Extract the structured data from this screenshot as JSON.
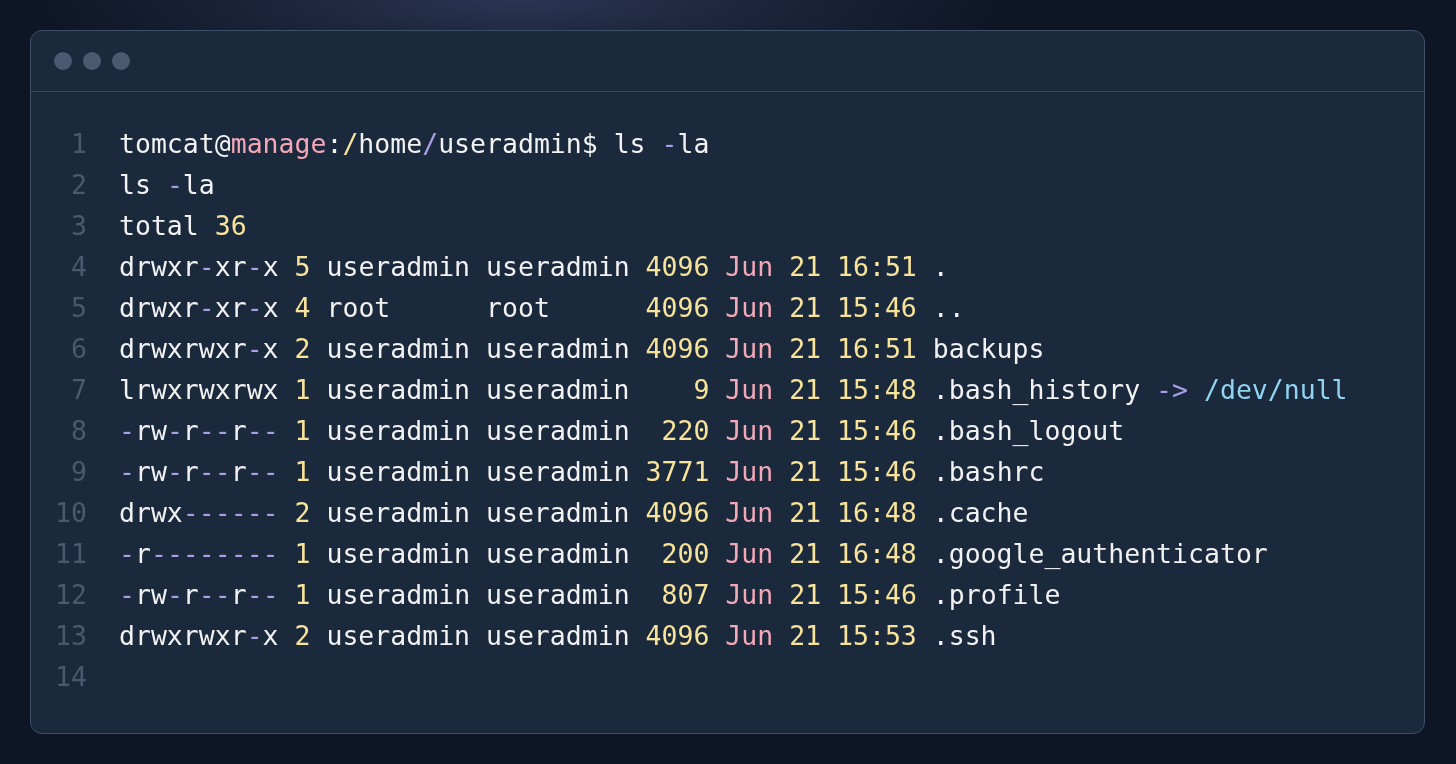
{
  "lines": [
    {
      "number": "1",
      "tokens": [
        {
          "text": "tomcat@",
          "kind": "plain"
        },
        {
          "text": "manage",
          "kind": "host"
        },
        {
          "text": ":",
          "kind": "plain"
        },
        {
          "text": "/",
          "kind": "separator"
        },
        {
          "text": "home",
          "kind": "plain"
        },
        {
          "text": "/",
          "kind": "operator"
        },
        {
          "text": "useradmin$ ls ",
          "kind": "plain"
        },
        {
          "text": "-",
          "kind": "operator"
        },
        {
          "text": "la",
          "kind": "plain"
        }
      ]
    },
    {
      "number": "2",
      "tokens": [
        {
          "text": "ls ",
          "kind": "plain"
        },
        {
          "text": "-",
          "kind": "operator"
        },
        {
          "text": "la",
          "kind": "plain"
        }
      ]
    },
    {
      "number": "3",
      "tokens": [
        {
          "text": "total ",
          "kind": "plain"
        },
        {
          "text": "36",
          "kind": "number"
        }
      ]
    },
    {
      "number": "4",
      "tokens": [
        {
          "text": "drwxr",
          "kind": "plain"
        },
        {
          "text": "-",
          "kind": "operator"
        },
        {
          "text": "xr",
          "kind": "plain"
        },
        {
          "text": "-",
          "kind": "operator"
        },
        {
          "text": "x ",
          "kind": "plain"
        },
        {
          "text": "5",
          "kind": "number"
        },
        {
          "text": " useradmin useradmin ",
          "kind": "plain"
        },
        {
          "text": "4096",
          "kind": "number"
        },
        {
          "text": " Jun",
          "kind": "host"
        },
        {
          "text": " 21 16:51",
          "kind": "number"
        },
        {
          "text": " .",
          "kind": "plain"
        }
      ]
    },
    {
      "number": "5",
      "tokens": [
        {
          "text": "drwxr",
          "kind": "plain"
        },
        {
          "text": "-",
          "kind": "operator"
        },
        {
          "text": "xr",
          "kind": "plain"
        },
        {
          "text": "-",
          "kind": "operator"
        },
        {
          "text": "x ",
          "kind": "plain"
        },
        {
          "text": "4",
          "kind": "number"
        },
        {
          "text": " root      root      ",
          "kind": "plain"
        },
        {
          "text": "4096",
          "kind": "number"
        },
        {
          "text": " Jun",
          "kind": "host"
        },
        {
          "text": " 21 15:46",
          "kind": "number"
        },
        {
          "text": " ..",
          "kind": "plain"
        }
      ]
    },
    {
      "number": "6",
      "tokens": [
        {
          "text": "drwxrwxr",
          "kind": "plain"
        },
        {
          "text": "-",
          "kind": "operator"
        },
        {
          "text": "x ",
          "kind": "plain"
        },
        {
          "text": "2",
          "kind": "number"
        },
        {
          "text": " useradmin useradmin ",
          "kind": "plain"
        },
        {
          "text": "4096",
          "kind": "number"
        },
        {
          "text": " Jun",
          "kind": "host"
        },
        {
          "text": " 21 16:51",
          "kind": "number"
        },
        {
          "text": " backups",
          "kind": "plain"
        }
      ]
    },
    {
      "number": "7",
      "tokens": [
        {
          "text": "lrwxrwxrwx ",
          "kind": "plain"
        },
        {
          "text": "1",
          "kind": "number"
        },
        {
          "text": " useradmin useradmin    ",
          "kind": "plain"
        },
        {
          "text": "9",
          "kind": "number"
        },
        {
          "text": " Jun",
          "kind": "host"
        },
        {
          "text": " 21 15:48",
          "kind": "number"
        },
        {
          "text": " .bash_history ",
          "kind": "plain"
        },
        {
          "text": "->",
          "kind": "operator"
        },
        {
          "text": " /dev/null",
          "kind": "path"
        }
      ]
    },
    {
      "number": "8",
      "tokens": [
        {
          "text": "-",
          "kind": "operator"
        },
        {
          "text": "rw",
          "kind": "plain"
        },
        {
          "text": "-",
          "kind": "operator"
        },
        {
          "text": "r",
          "kind": "plain"
        },
        {
          "text": "--",
          "kind": "operator"
        },
        {
          "text": "r",
          "kind": "plain"
        },
        {
          "text": "-- ",
          "kind": "operator"
        },
        {
          "text": "1",
          "kind": "number"
        },
        {
          "text": " useradmin useradmin  ",
          "kind": "plain"
        },
        {
          "text": "220",
          "kind": "number"
        },
        {
          "text": " Jun",
          "kind": "host"
        },
        {
          "text": " 21 15:46",
          "kind": "number"
        },
        {
          "text": " .bash_logout",
          "kind": "plain"
        }
      ]
    },
    {
      "number": "9",
      "tokens": [
        {
          "text": "-",
          "kind": "operator"
        },
        {
          "text": "rw",
          "kind": "plain"
        },
        {
          "text": "-",
          "kind": "operator"
        },
        {
          "text": "r",
          "kind": "plain"
        },
        {
          "text": "--",
          "kind": "operator"
        },
        {
          "text": "r",
          "kind": "plain"
        },
        {
          "text": "-- ",
          "kind": "operator"
        },
        {
          "text": "1",
          "kind": "number"
        },
        {
          "text": " useradmin useradmin ",
          "kind": "plain"
        },
        {
          "text": "3771",
          "kind": "number"
        },
        {
          "text": " Jun",
          "kind": "host"
        },
        {
          "text": " 21 15:46",
          "kind": "number"
        },
        {
          "text": " .bashrc",
          "kind": "plain"
        }
      ]
    },
    {
      "number": "10",
      "tokens": [
        {
          "text": "drwx",
          "kind": "plain"
        },
        {
          "text": "------ ",
          "kind": "operator"
        },
        {
          "text": "2",
          "kind": "number"
        },
        {
          "text": " useradmin useradmin ",
          "kind": "plain"
        },
        {
          "text": "4096",
          "kind": "number"
        },
        {
          "text": " Jun",
          "kind": "host"
        },
        {
          "text": " 21 16:48",
          "kind": "number"
        },
        {
          "text": " .cache",
          "kind": "plain"
        }
      ]
    },
    {
      "number": "11",
      "tokens": [
        {
          "text": "-",
          "kind": "operator"
        },
        {
          "text": "r",
          "kind": "plain"
        },
        {
          "text": "-------- ",
          "kind": "operator"
        },
        {
          "text": "1",
          "kind": "number"
        },
        {
          "text": " useradmin useradmin  ",
          "kind": "plain"
        },
        {
          "text": "200",
          "kind": "number"
        },
        {
          "text": " Jun",
          "kind": "host"
        },
        {
          "text": " 21 16:48",
          "kind": "number"
        },
        {
          "text": " .google_authenticator",
          "kind": "plain"
        }
      ]
    },
    {
      "number": "12",
      "tokens": [
        {
          "text": "-",
          "kind": "operator"
        },
        {
          "text": "rw",
          "kind": "plain"
        },
        {
          "text": "-",
          "kind": "operator"
        },
        {
          "text": "r",
          "kind": "plain"
        },
        {
          "text": "--",
          "kind": "operator"
        },
        {
          "text": "r",
          "kind": "plain"
        },
        {
          "text": "-- ",
          "kind": "operator"
        },
        {
          "text": "1",
          "kind": "number"
        },
        {
          "text": " useradmin useradmin  ",
          "kind": "plain"
        },
        {
          "text": "807",
          "kind": "number"
        },
        {
          "text": " Jun",
          "kind": "host"
        },
        {
          "text": " 21 15:46",
          "kind": "number"
        },
        {
          "text": " .profile",
          "kind": "plain"
        }
      ]
    },
    {
      "number": "13",
      "tokens": [
        {
          "text": "drwxrwxr",
          "kind": "plain"
        },
        {
          "text": "-",
          "kind": "operator"
        },
        {
          "text": "x ",
          "kind": "plain"
        },
        {
          "text": "2",
          "kind": "number"
        },
        {
          "text": " useradmin useradmin ",
          "kind": "plain"
        },
        {
          "text": "4096",
          "kind": "number"
        },
        {
          "text": " Jun",
          "kind": "host"
        },
        {
          "text": " 21 15:53",
          "kind": "number"
        },
        {
          "text": " .ssh",
          "kind": "plain"
        }
      ]
    },
    {
      "number": "14"
    }
  ]
}
